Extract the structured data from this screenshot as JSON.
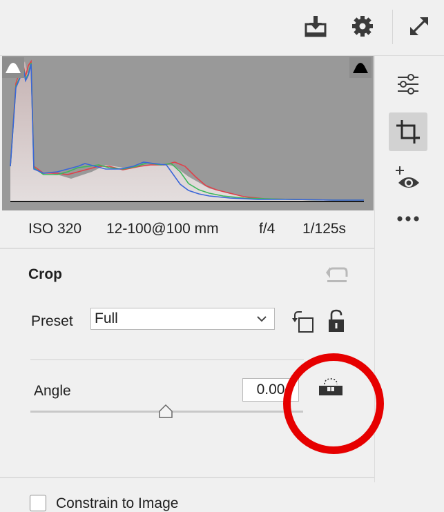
{
  "topbar": {
    "icons": [
      "download-icon",
      "gear-icon",
      "expand-icon"
    ]
  },
  "histogram": {
    "shadow_clip_icon": "shadow-clipping-icon",
    "highlight_clip_icon": "highlight-clipping-icon"
  },
  "exif": {
    "iso": "ISO 320",
    "lens": "12-100@100 mm",
    "aperture": "f/4",
    "shutter": "1/125s"
  },
  "crop": {
    "title": "Crop",
    "reset_icon": "reset-icon",
    "preset_label": "Preset",
    "preset_value": "Full",
    "rotate_icon": "rotate-crop-icon",
    "lock_icon": "unlock-icon",
    "angle_label": "Angle",
    "angle_value": "0.00",
    "angle_slider_fraction": 0.5,
    "level_tool_icon": "straighten-level-icon",
    "constrain_label": "Constrain to Image",
    "constrain_checked": false
  },
  "right_rail": {
    "items": [
      "edit-sliders-icon",
      "crop-icon",
      "red-eye-icon",
      "more-icon"
    ],
    "active": "crop-icon"
  },
  "colors": {
    "annotation": "#e60000",
    "histogram_bg": "#999999",
    "red_channel": "#e0404a",
    "green_channel": "#3cb85a",
    "blue_channel": "#3a66d8"
  }
}
